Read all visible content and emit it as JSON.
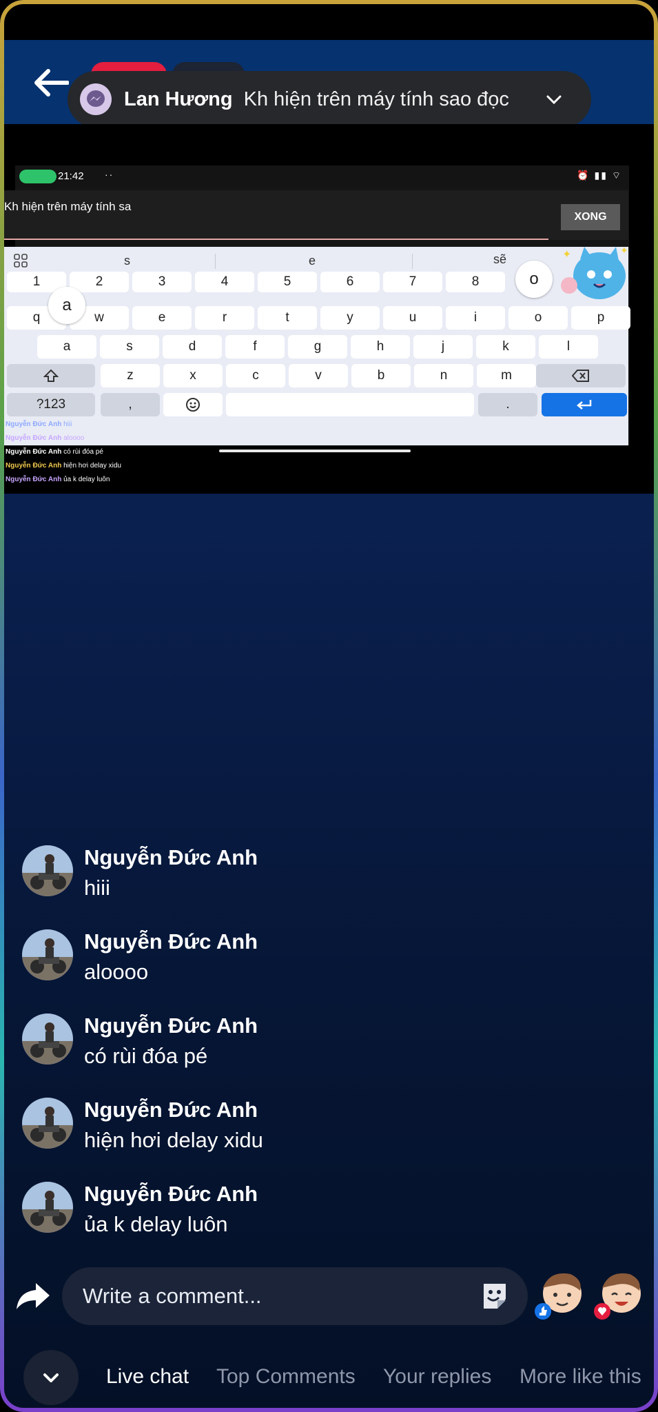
{
  "notification": {
    "sender": "Lan Hương",
    "message": "Kh hiện trên máy tính sao đọc"
  },
  "video": {
    "status_time": "21:42",
    "status_dots": "··",
    "input_text": "Kh hiện trên máy tính sa",
    "done_button": "XONG",
    "suggestions": [
      "s",
      "e",
      "sẽ"
    ],
    "number_row": [
      "1",
      "2",
      "3",
      "4",
      "5",
      "6",
      "7",
      "8"
    ],
    "row1": [
      "q",
      "w",
      "e",
      "r",
      "t",
      "y",
      "u",
      "i",
      "o",
      "p"
    ],
    "row2": [
      "a",
      "s",
      "d",
      "f",
      "g",
      "h",
      "j",
      "k",
      "l"
    ],
    "row3": [
      "z",
      "x",
      "c",
      "v",
      "b",
      "n",
      "m"
    ],
    "popup_a": "a",
    "popup_o": "o",
    "symbols_key": "?123",
    "comma_key": ",",
    "period_key": ".",
    "mini_comments": [
      {
        "name": "Nguyễn Đức Anh",
        "text": "hiii"
      },
      {
        "name": "Nguyễn Đức Anh",
        "text": "aloooo"
      },
      {
        "name": "Nguyễn Đức Anh",
        "text": "có rùi đóa pé"
      },
      {
        "name": "Nguyễn Đức Anh",
        "text": "hiện hơi delay xidu"
      },
      {
        "name": "Nguyễn Đức Anh",
        "text": "ủa k delay luôn"
      }
    ]
  },
  "comments": [
    {
      "name": "Nguyễn Đức Anh",
      "text": "hiii"
    },
    {
      "name": "Nguyễn Đức Anh",
      "text": "aloooo"
    },
    {
      "name": "Nguyễn Đức Anh",
      "text": "có rùi đóa pé"
    },
    {
      "name": "Nguyễn Đức Anh",
      "text": "hiện hơi delay xidu"
    },
    {
      "name": "Nguyễn Đức Anh",
      "text": "ủa k delay luôn"
    }
  ],
  "composer": {
    "placeholder": "Write a comment..."
  },
  "tabs": [
    "Live chat",
    "Top Comments",
    "Your replies",
    "More like this"
  ],
  "icons": {
    "back": "back-arrow-icon",
    "messenger": "messenger-icon",
    "share": "share-icon",
    "sticker": "sticker-icon",
    "collapse": "chevron-down-icon"
  },
  "colors": {
    "background": "#0a1f4d",
    "accent_blue": "#1673e6",
    "live_red": "#e41e3f"
  }
}
